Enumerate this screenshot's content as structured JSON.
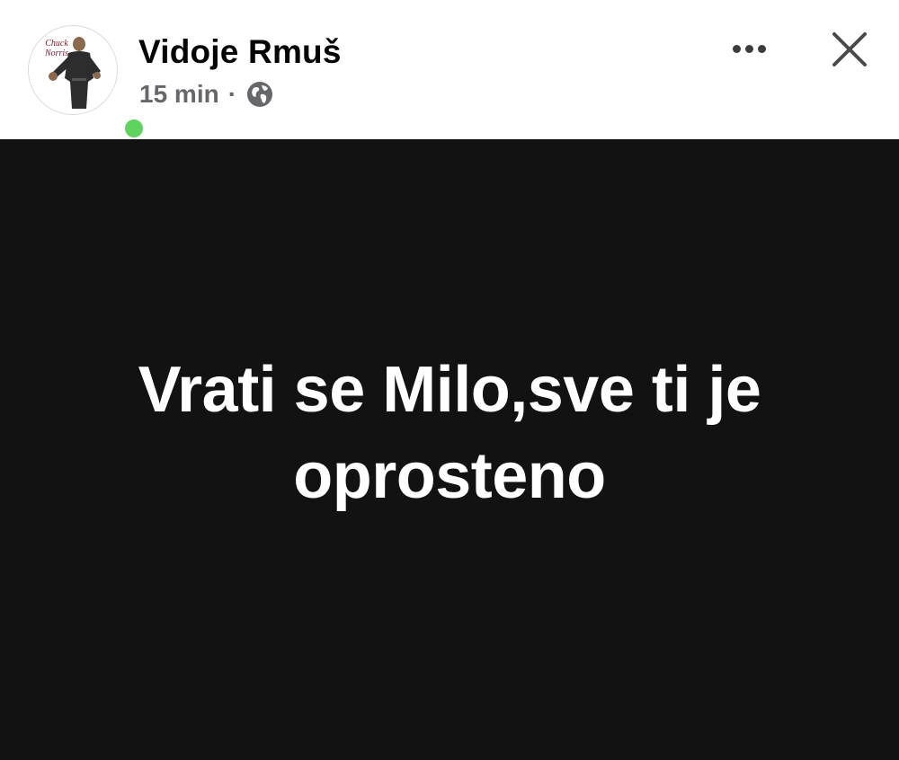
{
  "author": {
    "name": "Vidoje Rmuš",
    "avatar_caption": "Chuck Norris",
    "online": true
  },
  "meta": {
    "time": "15 min",
    "separator": "·",
    "audience_icon": "globe-icon"
  },
  "actions": {
    "more_icon": "more-options-icon",
    "close_icon": "close-icon"
  },
  "post": {
    "text": "Vrati se Milo,sve ti je oprosteno",
    "background_color": "#121212",
    "text_color": "#ffffff"
  },
  "colors": {
    "online_indicator": "#5fd35f",
    "meta_text": "#65676b"
  }
}
